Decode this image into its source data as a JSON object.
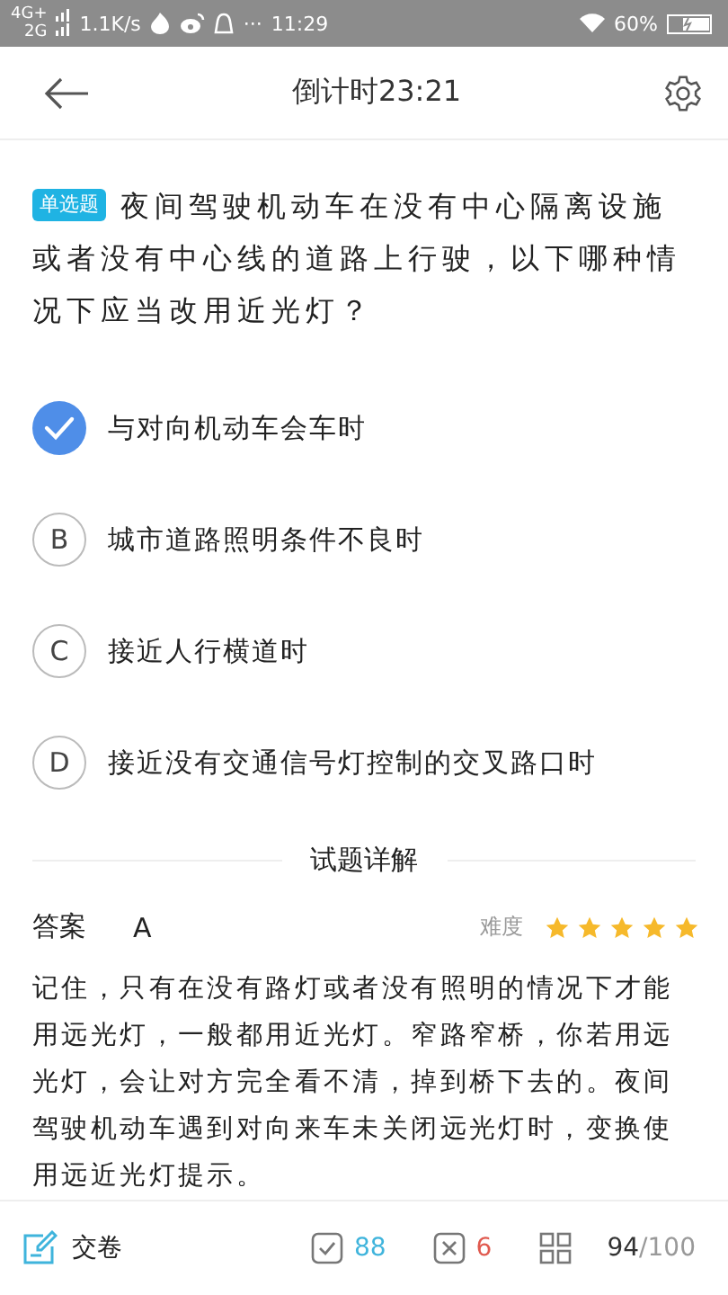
{
  "status_bar": {
    "network_top": "4G+",
    "network_bottom": "2G",
    "speed": "1.1K/s",
    "more": "···",
    "time": "11:29",
    "battery": "60%"
  },
  "header": {
    "title": "倒计时23:21"
  },
  "question": {
    "tag": "单选题",
    "text": "夜间驾驶机动车在没有中心隔离设施或者没有中心线的道路上行驶，以下哪种情况下应当改用近光灯？"
  },
  "options": [
    {
      "text": "与对向机动车会车时",
      "selected": true
    },
    {
      "letter": "B",
      "text": "城市道路照明条件不良时",
      "selected": false
    },
    {
      "letter": "C",
      "text": "接近人行横道时",
      "selected": false
    },
    {
      "letter": "D",
      "text": "接近没有交通信号灯控制的交叉路口时",
      "selected": false
    }
  ],
  "details": {
    "heading": "试题详解",
    "answer_label": "答案",
    "answer": "A",
    "difficulty_label": "难度",
    "stars": 5,
    "explanation": "记住，只有在没有路灯或者没有照明的情况下才能用远光灯，一般都用近光灯。窄路窄桥，你若用远光灯，会让对方完全看不清，掉到桥下去的。夜间驾驶机动车遇到对向来车未关闭远光灯时，变换使用远近光灯提示。"
  },
  "bottom_bar": {
    "submit": "交卷",
    "correct": "88",
    "wrong": "6",
    "current": "94",
    "total": "/100"
  }
}
